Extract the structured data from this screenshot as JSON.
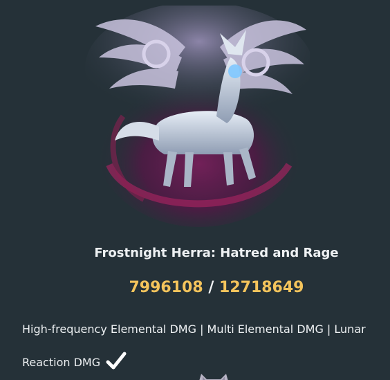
{
  "boss": {
    "name": "Frostnight Herra: Hatred and Rage",
    "hp_current": "7996108",
    "hp_separator": " / ",
    "hp_max": "12718649",
    "tags_text": "High-frequency Elemental DMG | Multi Elemental DMG | Lunar Reaction DMG",
    "check_icon": "checkmark-icon",
    "art_icon": "frostnight-herra-boss-art"
  },
  "colors": {
    "background": "#253138",
    "hp_value": "#f4c45c",
    "text": "#eef1f3"
  }
}
